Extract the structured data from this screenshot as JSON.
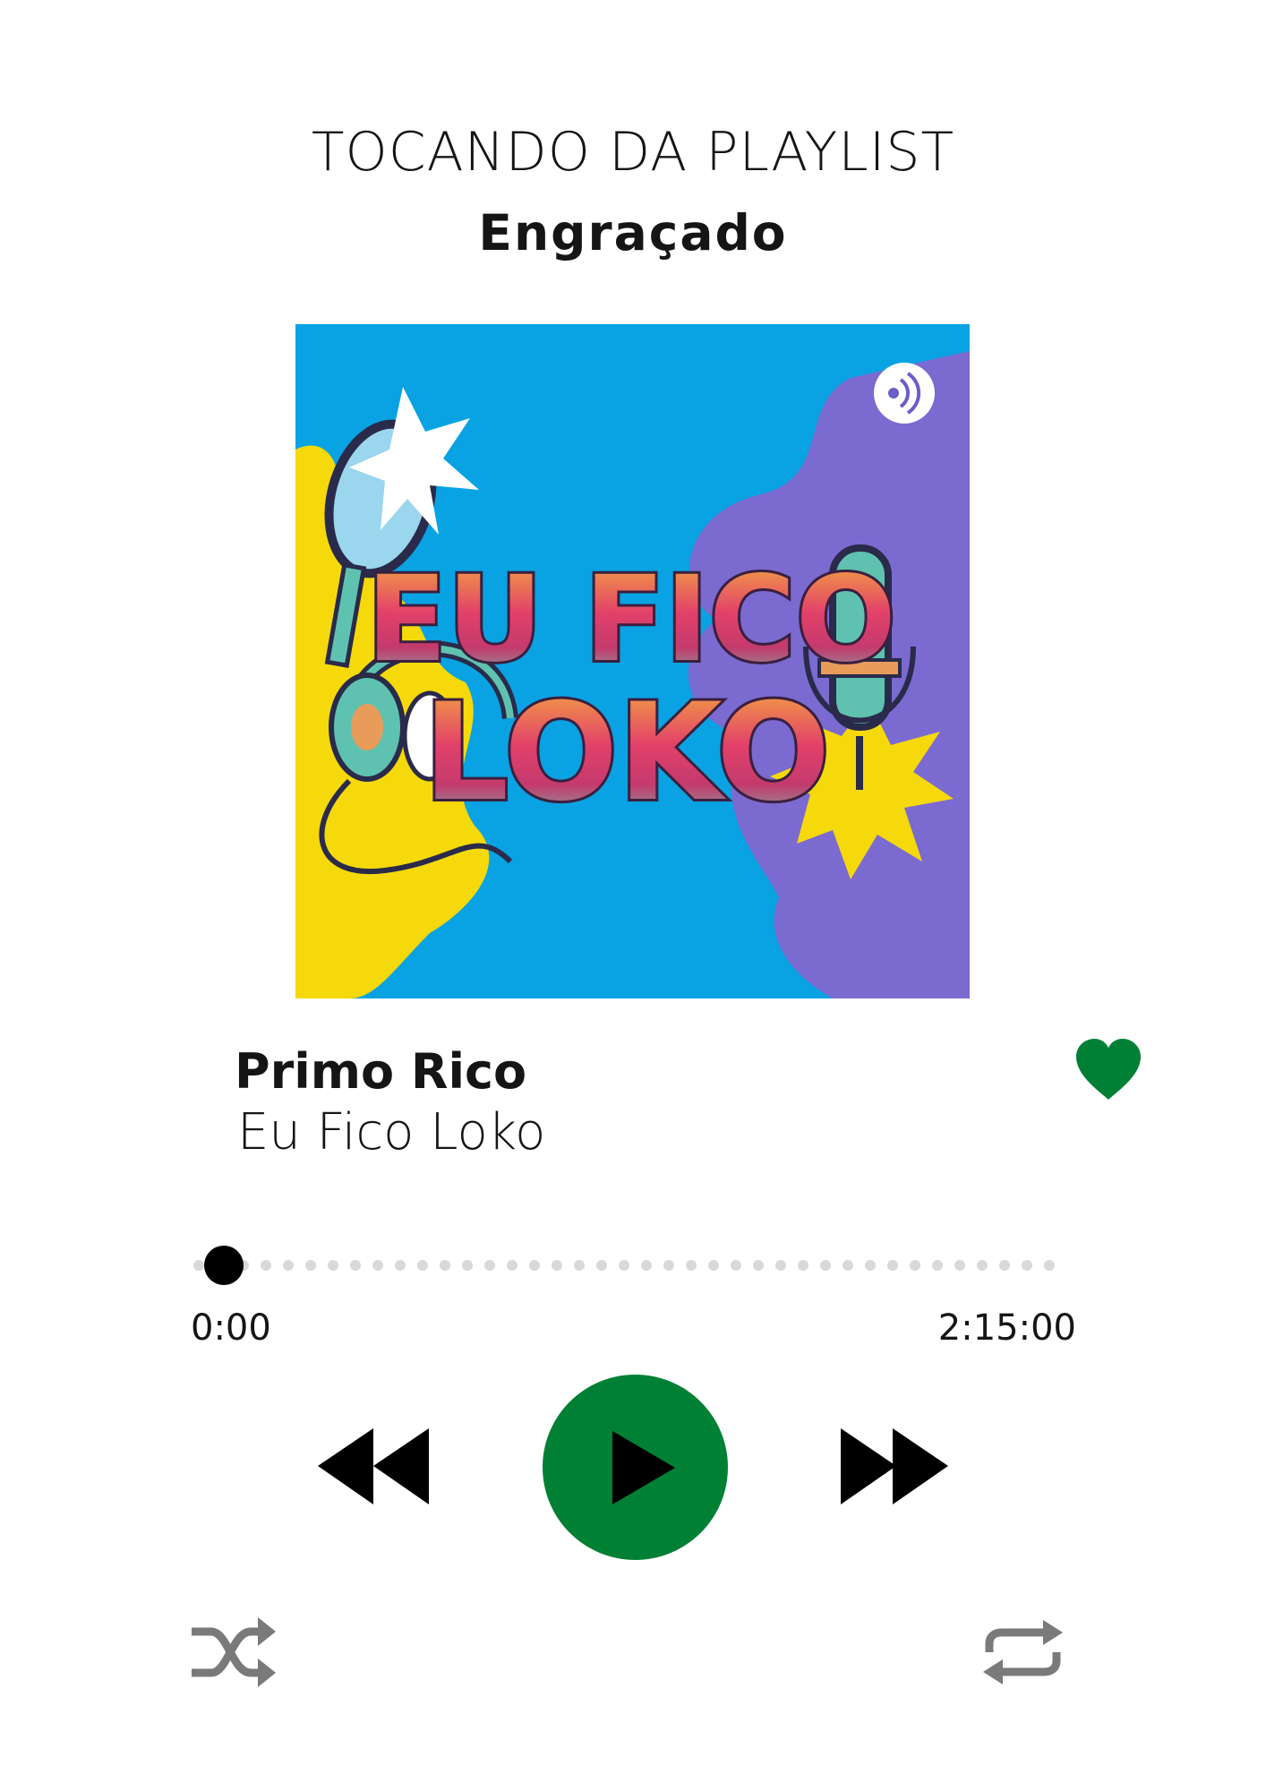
{
  "header": {
    "label": "TOCANDO DA PLAYLIST",
    "playlist_name": "Engraçado"
  },
  "cover": {
    "text_line1": "EU FICO",
    "text_line2": "LOKO",
    "colors": {
      "sky": "#09a3e3",
      "yellow": "#f5d90a",
      "purple": "#7b6ad0",
      "title_gradient_top": "#f5b43a",
      "title_gradient_bottom": "#6ec7b2"
    }
  },
  "track": {
    "title": "Primo Rico",
    "artist": "Eu Fico Loko",
    "liked": true
  },
  "progress": {
    "current_time": "0:00",
    "total_time": "2:15:00",
    "position_fraction": 0.0
  },
  "controls": {
    "rewind_icon": "rewind-icon",
    "play_icon": "play-icon",
    "forward_icon": "fast-forward-icon",
    "shuffle_icon": "shuffle-icon",
    "repeat_icon": "repeat-icon"
  },
  "colors": {
    "accent": "#008034",
    "text": "#151515",
    "dot": "#d9d9d9",
    "secondary_icon": "#7a7a7a"
  }
}
